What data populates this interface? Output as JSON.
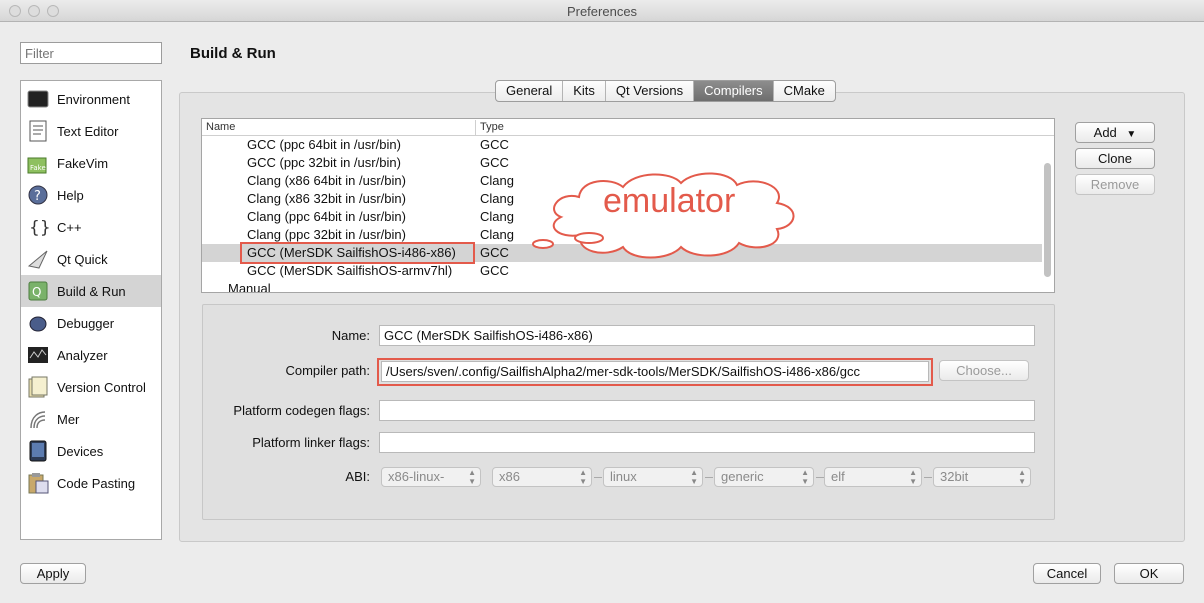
{
  "window": {
    "title": "Preferences"
  },
  "filter": {
    "placeholder": "Filter"
  },
  "sidebar": {
    "items": [
      {
        "label": "Environment",
        "icon": "monitor-icon"
      },
      {
        "label": "Text Editor",
        "icon": "text-document-icon"
      },
      {
        "label": "FakeVim",
        "icon": "fakevim-icon"
      },
      {
        "label": "Help",
        "icon": "help-icon"
      },
      {
        "label": "C++",
        "icon": "braces-icon"
      },
      {
        "label": "Qt Quick",
        "icon": "qtquick-icon"
      },
      {
        "label": "Build & Run",
        "icon": "qt-build-icon",
        "active": true
      },
      {
        "label": "Debugger",
        "icon": "bug-icon"
      },
      {
        "label": "Analyzer",
        "icon": "analyzer-icon"
      },
      {
        "label": "Version Control",
        "icon": "version-control-icon"
      },
      {
        "label": "Mer",
        "icon": "mer-icon"
      },
      {
        "label": "Devices",
        "icon": "device-icon"
      },
      {
        "label": "Code Pasting",
        "icon": "clipboard-icon"
      }
    ]
  },
  "page": {
    "title": "Build & Run"
  },
  "tabs": [
    "General",
    "Kits",
    "Qt Versions",
    "Compilers",
    "CMake"
  ],
  "active_tab": "Compilers",
  "compiler_list": {
    "headers": {
      "name": "Name",
      "type": "Type"
    },
    "rows": [
      {
        "name": "GCC (ppc 64bit in /usr/bin)",
        "type": "GCC"
      },
      {
        "name": "GCC (ppc 32bit in /usr/bin)",
        "type": "GCC"
      },
      {
        "name": "Clang (x86 64bit in /usr/bin)",
        "type": "Clang"
      },
      {
        "name": "Clang (x86 32bit in /usr/bin)",
        "type": "Clang"
      },
      {
        "name": "Clang (ppc 64bit in /usr/bin)",
        "type": "Clang"
      },
      {
        "name": "Clang (ppc 32bit in /usr/bin)",
        "type": "Clang"
      },
      {
        "name": "GCC (MerSDK SailfishOS-i486-x86)",
        "type": "GCC",
        "selected": true
      },
      {
        "name": "GCC (MerSDK SailfishOS-armv7hl)",
        "type": "GCC"
      }
    ],
    "manual_label": "Manual"
  },
  "annotation": {
    "text": "emulator"
  },
  "buttons": {
    "add": "Add",
    "clone": "Clone",
    "remove": "Remove",
    "choose": "Choose...",
    "apply": "Apply",
    "cancel": "Cancel",
    "ok": "OK"
  },
  "details": {
    "name_label": "Name:",
    "name_value": "GCC (MerSDK SailfishOS-i486-x86)",
    "path_label": "Compiler path:",
    "path_value": "/Users/sven/.config/SailfishAlpha2/mer-sdk-tools/MerSDK/SailfishOS-i486-x86/gcc",
    "codegen_label": "Platform codegen flags:",
    "codegen_value": "",
    "linker_label": "Platform linker flags:",
    "linker_value": "",
    "abi_label": "ABI:",
    "abi": [
      "x86-linux-",
      "x86",
      "linux",
      "generic",
      "elf",
      "32bit"
    ]
  },
  "colors": {
    "highlight": "#e35a4b",
    "selected_row": "#d4d4d4"
  }
}
